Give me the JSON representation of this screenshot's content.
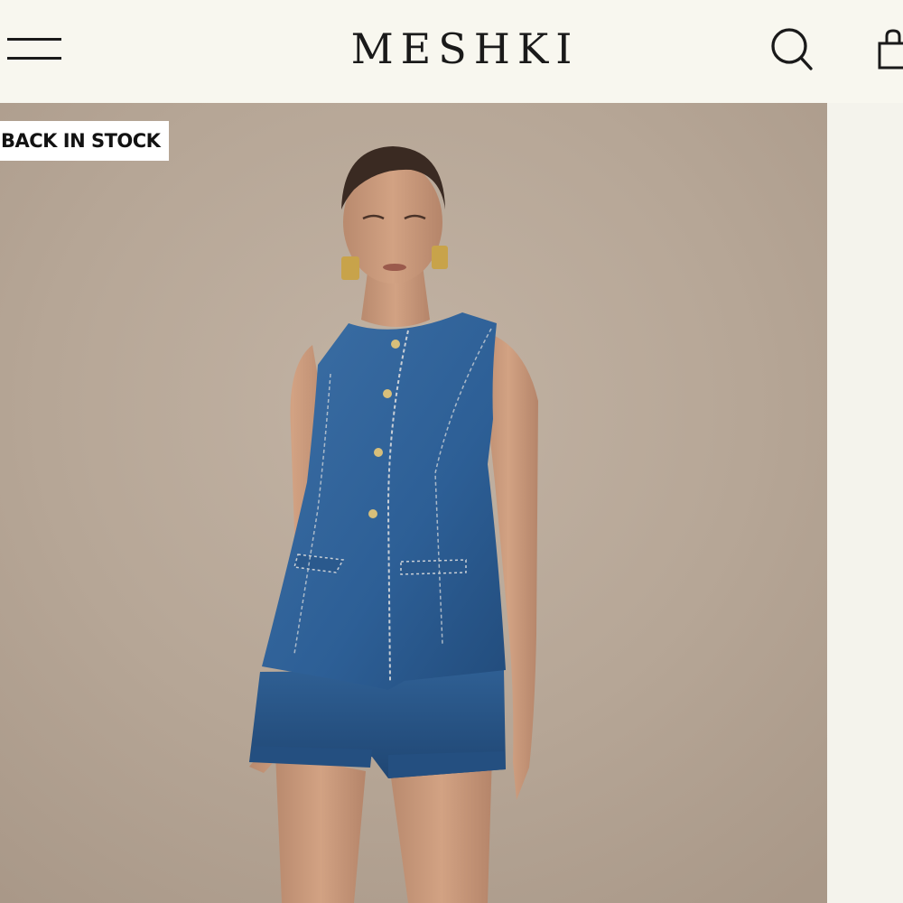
{
  "header": {
    "brand": "MESHKI",
    "menu_icon": "hamburger-menu-icon",
    "search_icon": "search-icon",
    "cart_icon": "shopping-bag-icon"
  },
  "product": {
    "badge": "BACK IN STOCK",
    "image_subject": "model-wearing-denim-vest-and-shorts",
    "colors": {
      "background": "#f8f7ef",
      "badge_bg": "#ffffff",
      "photo_backdrop": "#b9a999",
      "denim": "#2d5f96"
    }
  }
}
